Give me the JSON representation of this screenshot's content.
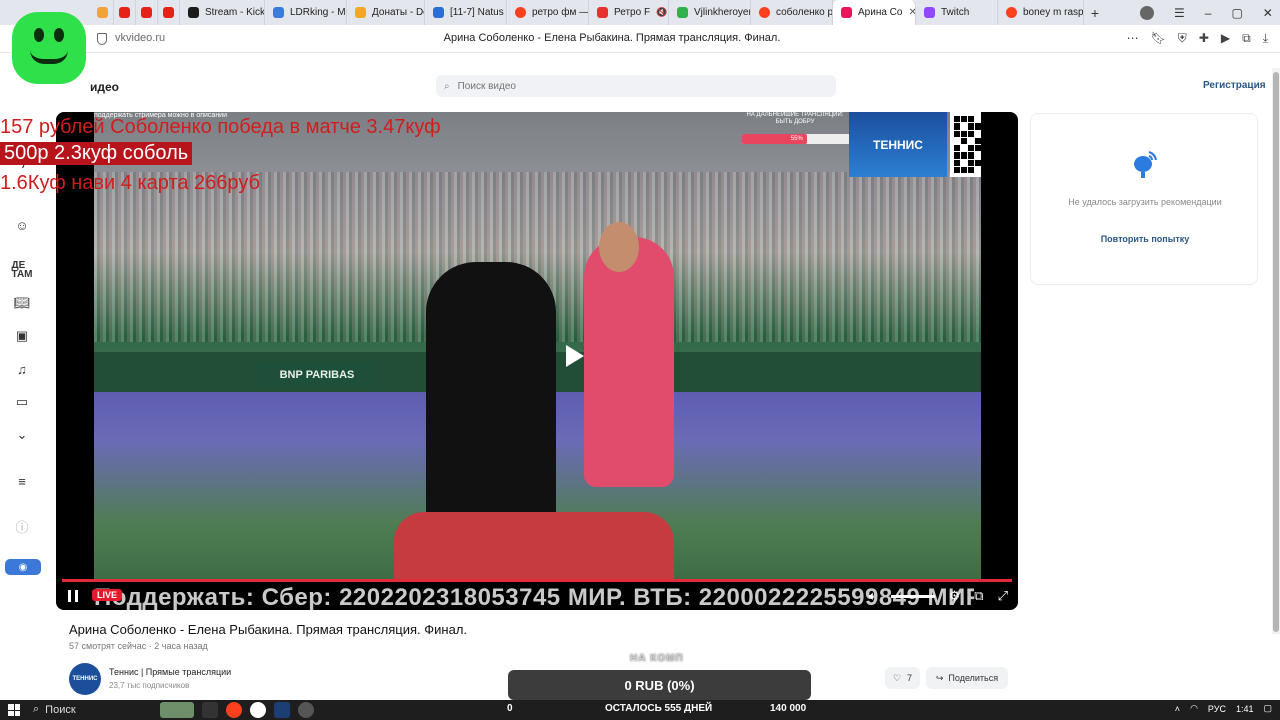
{
  "browser": {
    "tabs": [
      {
        "label": "",
        "favicon_color": "#f3a23a"
      },
      {
        "label": "",
        "favicon_color": "#e62117"
      },
      {
        "label": "",
        "favicon_color": "#e62117"
      },
      {
        "label": "",
        "favicon_color": "#e62117"
      },
      {
        "label": "Stream - Kick",
        "favicon_color": "#1b1b1b"
      },
      {
        "label": "LDRking - Me",
        "favicon_color": "#3a7be0"
      },
      {
        "label": "Донаты - Do",
        "favicon_color": "#f5a623"
      },
      {
        "label": "[11-7] Natus",
        "favicon_color": "#2b6fd6"
      },
      {
        "label": "ретро фм —",
        "favicon_color": "#fc3f1d"
      },
      {
        "label": "Ретро F",
        "favicon_color": "#e8312c"
      },
      {
        "label": "Vjlinkheroyer",
        "favicon_color": "#2fb24b"
      },
      {
        "label": "соболенко р",
        "favicon_color": "#fc3f1d"
      },
      {
        "label": "Арина Со",
        "favicon_color": "#e9155a"
      },
      {
        "label": "Twitch",
        "favicon_color": "#9146ff"
      },
      {
        "label": "boney m rasp",
        "favicon_color": "#fc3f1d"
      }
    ],
    "add_tab": "+",
    "url": "vkvideo.ru",
    "page_title": "Арина Соболенко - Елена Рыбакина. Прямая трансляция. Финал.",
    "window_controls": {
      "minimize": "–",
      "restore": "▢",
      "close": "✕"
    }
  },
  "site": {
    "brand_suffix": "идео",
    "search_placeholder": "Поиск видео",
    "register_label": "Регистрация"
  },
  "overlay": {
    "line1": "157 рублей Соболенко победа в матче 3.47куф",
    "line2": "500р 2.3куф соболь",
    "line3": "1.6Куф нави 4 карта 266руб",
    "promo_strip": "поддержать стримера можно в описании",
    "next_broadcast": "НА ДАЛЬНЕЙШИЕ ТРАНСЛЯЦИИ: БЫТЬ ДОБРУ",
    "next_value": "55%",
    "tennis_logo": "ТЕННИС",
    "ad_board": "BNP PARIBAS",
    "ticker": "Поддержать: Сбер: 2202202318053745 МИР. ВТБ: 2200022225599849 МИР"
  },
  "player": {
    "live_label": "LIVE"
  },
  "video": {
    "title": "Арина Соболенко - Елена Рыбакина. Прямая трансляция. Финал.",
    "viewers": "57 смотрят сейчас",
    "age": "2 часа назад",
    "channel_avatar_text": "ТЕННИС",
    "channel_name": "Теннис | Прямые трансляции",
    "channel_subs": "23,7 тыс подписчиков",
    "likes": "7",
    "share_label": "Поделиться"
  },
  "donation": {
    "label": "НА КОМП",
    "amount": "0 RUB (0%)",
    "start": "0",
    "remaining": "ОСТАЛОСЬ 555 ДНЕЙ",
    "goal": "140 000"
  },
  "recommendations": {
    "error_text": "Не удалось загрузить рекомендации",
    "retry_label": "Повторить попытку"
  },
  "taskbar": {
    "search_label": "Поиск",
    "lang": "РУС",
    "time": "1:41"
  }
}
